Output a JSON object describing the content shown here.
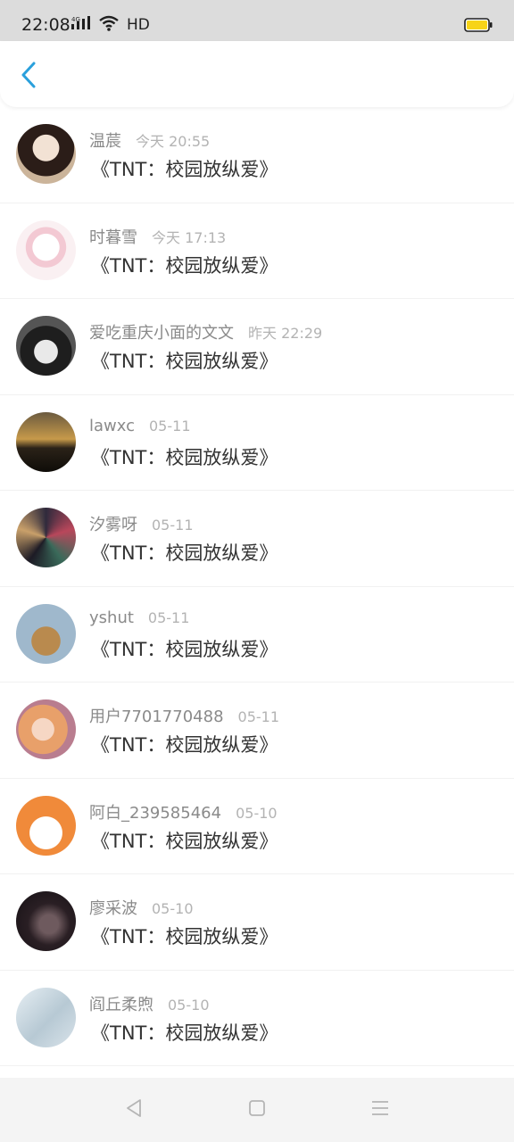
{
  "status_bar": {
    "time": "22:08",
    "network": "4G",
    "quality": "HD",
    "battery_color": "#f7d417"
  },
  "header": {
    "back_icon": "chevron-left-icon",
    "accent": "#2aa0dc"
  },
  "items": [
    {
      "name": "温莀",
      "time": "今天 20:55",
      "title": "《TNT：校园放纵爱》",
      "avatar_bg": "#cbb49a"
    },
    {
      "name": "时暮雪",
      "time": "今天 17:13",
      "title": "《TNT：校园放纵爱》",
      "avatar_bg": "#f8e6ea"
    },
    {
      "name": "爱吃重庆小面的文文",
      "time": "昨天 22:29",
      "title": "《TNT：校园放纵爱》",
      "avatar_bg": "#4a4a4a"
    },
    {
      "name": "lawxc",
      "time": "05-11",
      "title": "《TNT：校园放纵爱》",
      "avatar_bg": "#8a6a3a"
    },
    {
      "name": "汐雾呀",
      "time": "05-11",
      "title": "《TNT：校园放纵爱》",
      "avatar_bg": "#3f3a4a"
    },
    {
      "name": "yshut",
      "time": "05-11",
      "title": "《TNT：校园放纵爱》",
      "avatar_bg": "#9fb8cc"
    },
    {
      "name": "用户7701770488",
      "time": "05-11",
      "title": "《TNT：校园放纵爱》",
      "avatar_bg": "#e8b27a"
    },
    {
      "name": "阿白_239585464",
      "time": "05-10",
      "title": "《TNT：校园放纵爱》",
      "avatar_bg": "#f08a3a"
    },
    {
      "name": "廖采波",
      "time": "05-10",
      "title": "《TNT：校园放纵爱》",
      "avatar_bg": "#2a1f24"
    },
    {
      "name": "阎丘柔煦",
      "time": "05-10",
      "title": "《TNT：校园放纵爱》",
      "avatar_bg": "#c9d7e0"
    }
  ],
  "nav_bar": {
    "back_icon": "triangle-back-icon",
    "home_icon": "square-home-icon",
    "menu_icon": "menu-lines-icon"
  }
}
